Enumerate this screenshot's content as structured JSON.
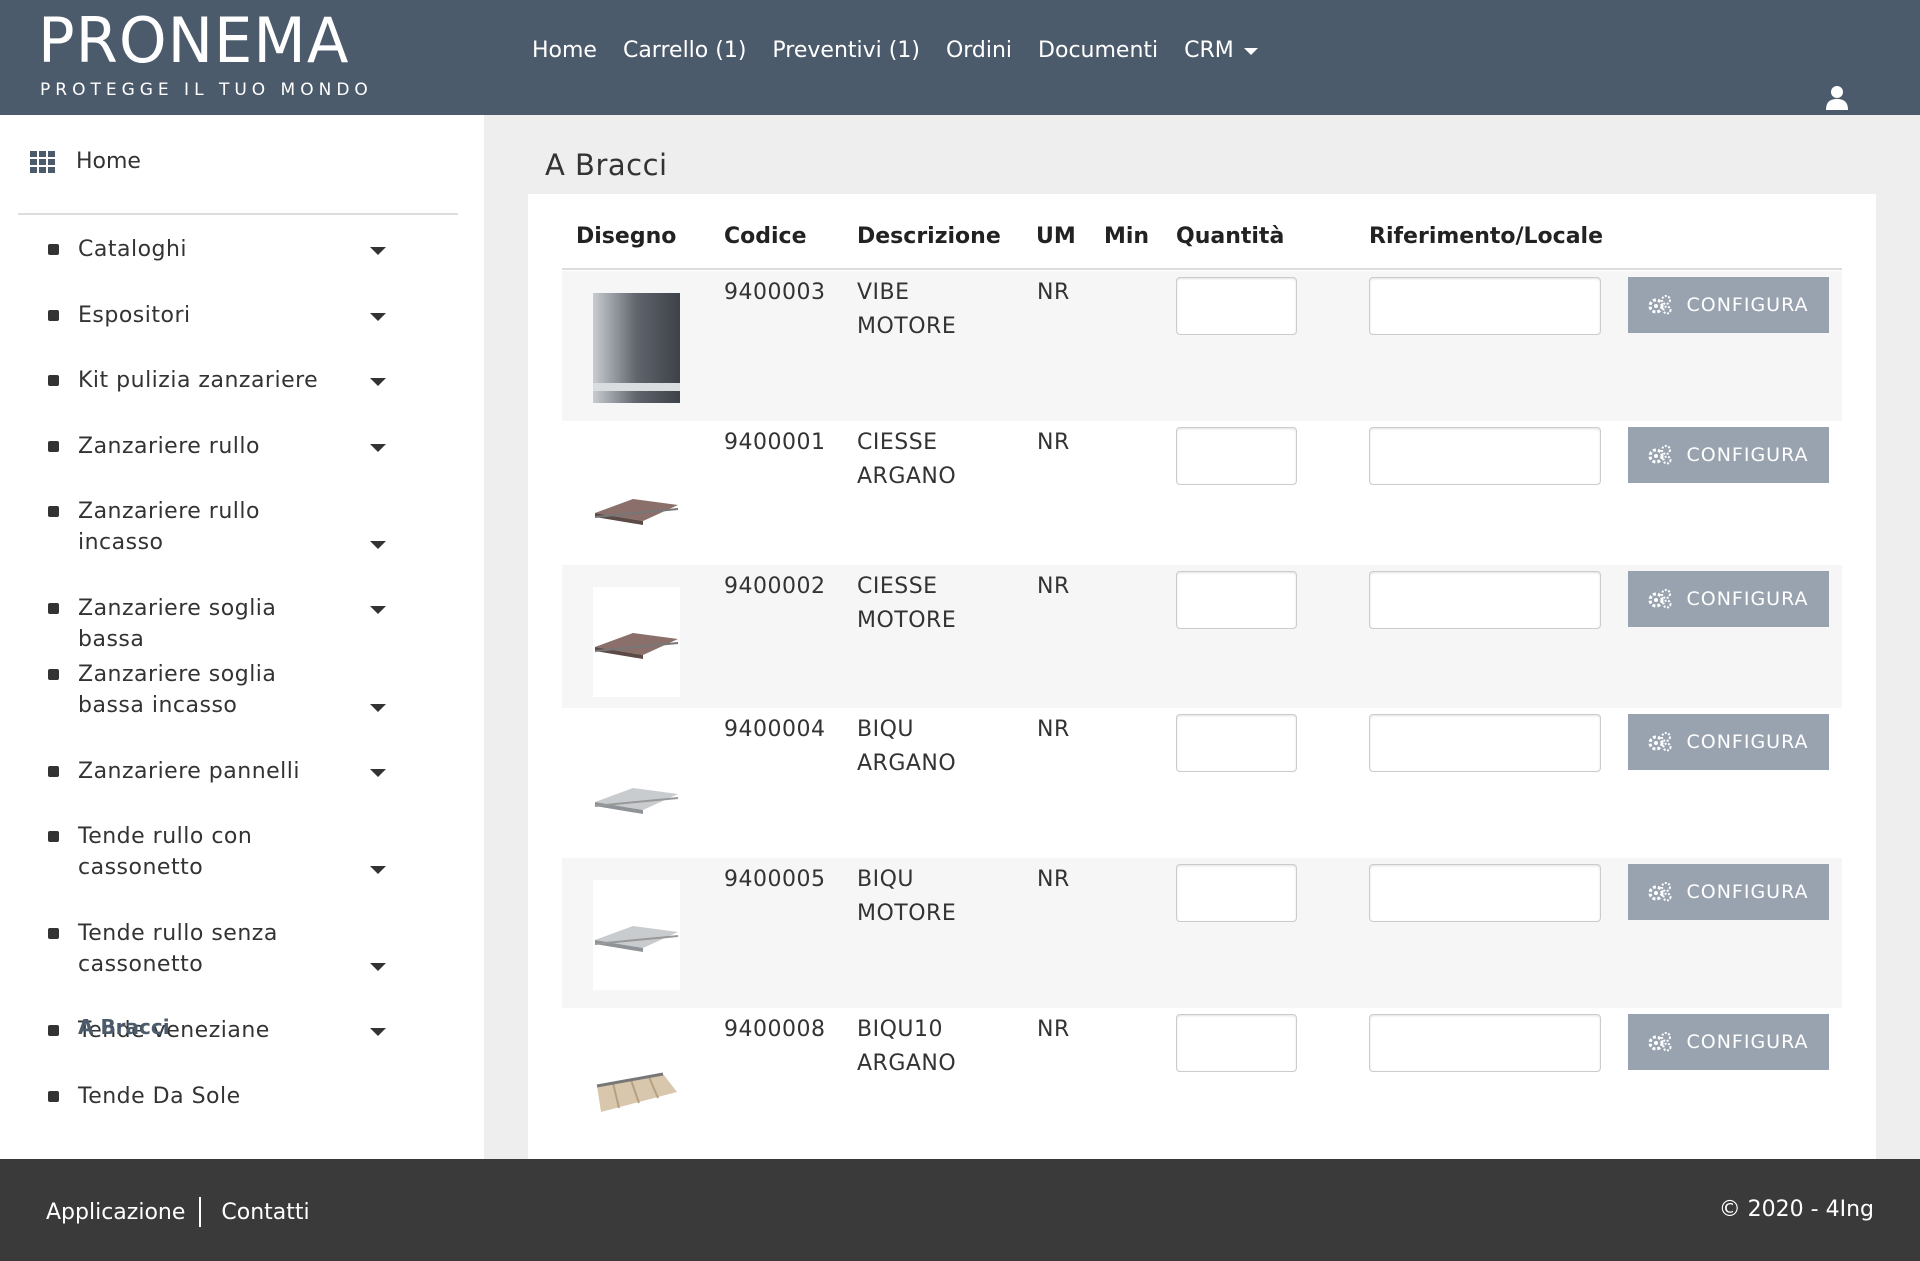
{
  "header": {
    "logo_main": "PRONEMA",
    "logo_sub": "PROTEGGE IL TUO MONDO",
    "nav": [
      {
        "label": "Home"
      },
      {
        "label": "Carrello (1)"
      },
      {
        "label": "Preventivi (1)"
      },
      {
        "label": "Ordini"
      },
      {
        "label": "Documenti"
      },
      {
        "label": "CRM"
      }
    ]
  },
  "sidebar": {
    "home_label": "Home",
    "items": [
      {
        "label": "Cataloghi"
      },
      {
        "label": "Espositori"
      },
      {
        "label": "Kit pulizia zanzariere"
      },
      {
        "label": "Zanzariere rullo"
      },
      {
        "label": "Zanzariere rullo incasso"
      },
      {
        "label": "Zanzariere soglia bassa"
      },
      {
        "label": "Zanzariere soglia bassa incasso"
      },
      {
        "label": "Zanzariere pannelli"
      },
      {
        "label": "Tende rullo con cassonetto"
      },
      {
        "label": "Tende rullo senza cassonetto"
      },
      {
        "label": "Tende veneziane"
      },
      {
        "label": "Tende Da Sole"
      }
    ],
    "active_sub": "A Bracci"
  },
  "main": {
    "title": "A Bracci",
    "columns": {
      "drawing": "Disegno",
      "code": "Codice",
      "description": "Descrizione",
      "um": "UM",
      "min": "Min",
      "quantity": "Quantità",
      "reference": "Riferimento/Locale"
    },
    "configure_label": "CONFIGURA",
    "rows": [
      {
        "code": "9400003",
        "desc1": "VIBE",
        "desc2": "MOTORE",
        "um": "NR",
        "min": "",
        "qty": "",
        "ref": ""
      },
      {
        "code": "9400001",
        "desc1": "CIESSE",
        "desc2": "ARGANO",
        "um": "NR",
        "min": "",
        "qty": "",
        "ref": ""
      },
      {
        "code": "9400002",
        "desc1": "CIESSE",
        "desc2": "MOTORE",
        "um": "NR",
        "min": "",
        "qty": "",
        "ref": ""
      },
      {
        "code": "9400004",
        "desc1": "BIQU",
        "desc2": "ARGANO",
        "um": "NR",
        "min": "",
        "qty": "",
        "ref": ""
      },
      {
        "code": "9400005",
        "desc1": "BIQU",
        "desc2": "MOTORE",
        "um": "NR",
        "min": "",
        "qty": "",
        "ref": ""
      },
      {
        "code": "9400008",
        "desc1": "BIQU10",
        "desc2": "ARGANO",
        "um": "NR",
        "min": "",
        "qty": "",
        "ref": ""
      }
    ]
  },
  "footer": {
    "link1": "Applicazione",
    "link2": "Contatti",
    "copyright": "© 2020 - 4Ing"
  },
  "colors": {
    "header_bg": "#4c5b6b",
    "button_bg": "#99a3b0",
    "footer_bg": "#3a3a3a"
  },
  "icons": {
    "home": "grid-icon",
    "user": "user-icon",
    "configure": "gears-icon",
    "menu_toggle": "caret-down-icon"
  }
}
